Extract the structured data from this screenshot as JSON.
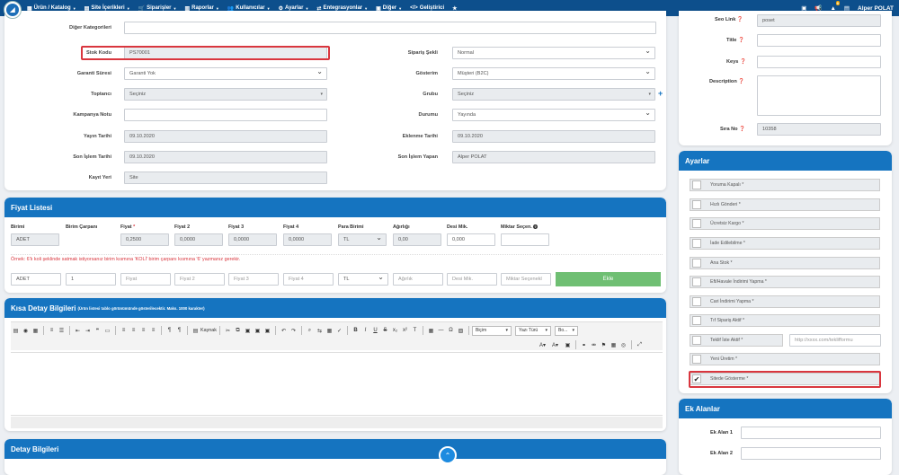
{
  "nav": {
    "items": [
      {
        "icon": "▦",
        "label": "Ürün / Katalog"
      },
      {
        "icon": "▤",
        "label": "Site İçerikleri"
      },
      {
        "icon": "🛒",
        "label": "Siparişler"
      },
      {
        "icon": "▥",
        "label": "Raporlar"
      },
      {
        "icon": "👥",
        "label": "Kullanıcılar"
      },
      {
        "icon": "⚙",
        "label": "Ayarlar"
      },
      {
        "icon": "⇄",
        "label": "Entegrasyonlar"
      },
      {
        "icon": "▣",
        "label": "Diğer"
      },
      {
        "icon": "</>",
        "label": "Geliştirici"
      }
    ],
    "user_name": "Alper POLAT",
    "alert_count": "8"
  },
  "product": {
    "diger_kategoriler": "Diğer Kategorileri",
    "stok_kodu_label": "Stok Kodu",
    "stok_kodu": "PS70001",
    "garanti_label": "Garanti Süresi",
    "garanti": "Garanti Yok",
    "toptanci_label": "Toptancı",
    "toptanci": "Seçiniz",
    "kampanya_label": "Kampanya Notu",
    "yayin_label": "Yayın Tarihi",
    "yayin": "09.10.2020",
    "son_islem_label": "Son İşlem Tarihi",
    "son_islem": "09.10.2020",
    "kayit_label": "Kayıt Yeri",
    "kayit": "Site",
    "siparis_sekli_label": "Sipariş Şekli",
    "siparis_sekli": "Normal",
    "gosterim_label": "Gösterim",
    "gosterim": "Müşteri (B2C)",
    "grubu_label": "Grubu",
    "grubu": "Seçiniz",
    "durumu_label": "Durumu",
    "durumu": "Yayında",
    "eklenme_label": "Eklenme Tarihi",
    "eklenme": "09.10.2020",
    "son_islem_yapan_label": "Son İşlem Yapan",
    "son_islem_yapan": "Alper POLAT"
  },
  "fiyat": {
    "title": "Fiyat Listesi",
    "headers": [
      "Birimi",
      "Birim Çarpanı",
      "Fiyat",
      "Fiyat 2",
      "Fiyat 3",
      "Fiyat 4",
      "Para Birimi",
      "Ağırlığı",
      "Desi Mik.",
      "Miktar Seçen."
    ],
    "row": {
      "birimi": "ADET",
      "fiyat": "0,2500",
      "fiyat2": "0,0000",
      "fiyat3": "0,0000",
      "fiyat4": "0,0000",
      "para": "TL",
      "agirlik": "0,00",
      "desi": "0,000"
    },
    "note": "Örnek: 6'lı koli şeklinde satmak istiyorsanız birim kısmına 'KOLİ' birim çarpanı kısmına '6' yazmanız gerekir.",
    "new_row": {
      "birimi": "ADET",
      "carpan": "1",
      "fiyat_ph": "Fiyat",
      "fiyat2_ph": "Fiyat 2",
      "fiyat3_ph": "Fiyat 3",
      "fiyat4_ph": "Fiyat 4",
      "para": "TL",
      "agirlik_ph": "Ağırlık",
      "desi_ph": "Desi Mik.",
      "miktar_ph": "Miktar Seçenekl",
      "add": "Ekle"
    }
  },
  "kisa": {
    "title": "Kısa Detay Bilgileri",
    "subtitle": "(Ürün listesi tablo görünümünde gösterilecektir. Maks. 1000 karakter)",
    "kaynak": "Kaynak",
    "bicim": "Biçim",
    "yazi_turu": "Yazı Türü",
    "boyut": "Bo..."
  },
  "detay": {
    "title": "Detay Bilgileri"
  },
  "seo": {
    "seo_link_label": "Seo Link",
    "seo_link": "poset",
    "title_label": "Title",
    "keys_label": "Keys",
    "description_label": "Description",
    "sira_no_label": "Sıra No",
    "sira_no": "10358"
  },
  "ayarlar": {
    "title": "Ayarlar",
    "items": [
      "Yoruma Kapalı *",
      "Hızlı Gönderi *",
      "Ücretsiz Kargo *",
      "İade Edilebilme *",
      "Ana Stok *",
      "Eft/Havale İndirimi Yapma *",
      "Cari İndirimi Yapma *",
      "Tıf Sipariş Aktif *",
      "Teklif İste Aktif *",
      "Yeni Üretim *",
      "Sitede Gösterme *"
    ],
    "teklif_ph": "http://xxxx.com/teklifformu"
  },
  "ek": {
    "title": "Ek Alanlar",
    "alan1": "Ek Alan 1",
    "alan2": "Ek Alan 2"
  }
}
